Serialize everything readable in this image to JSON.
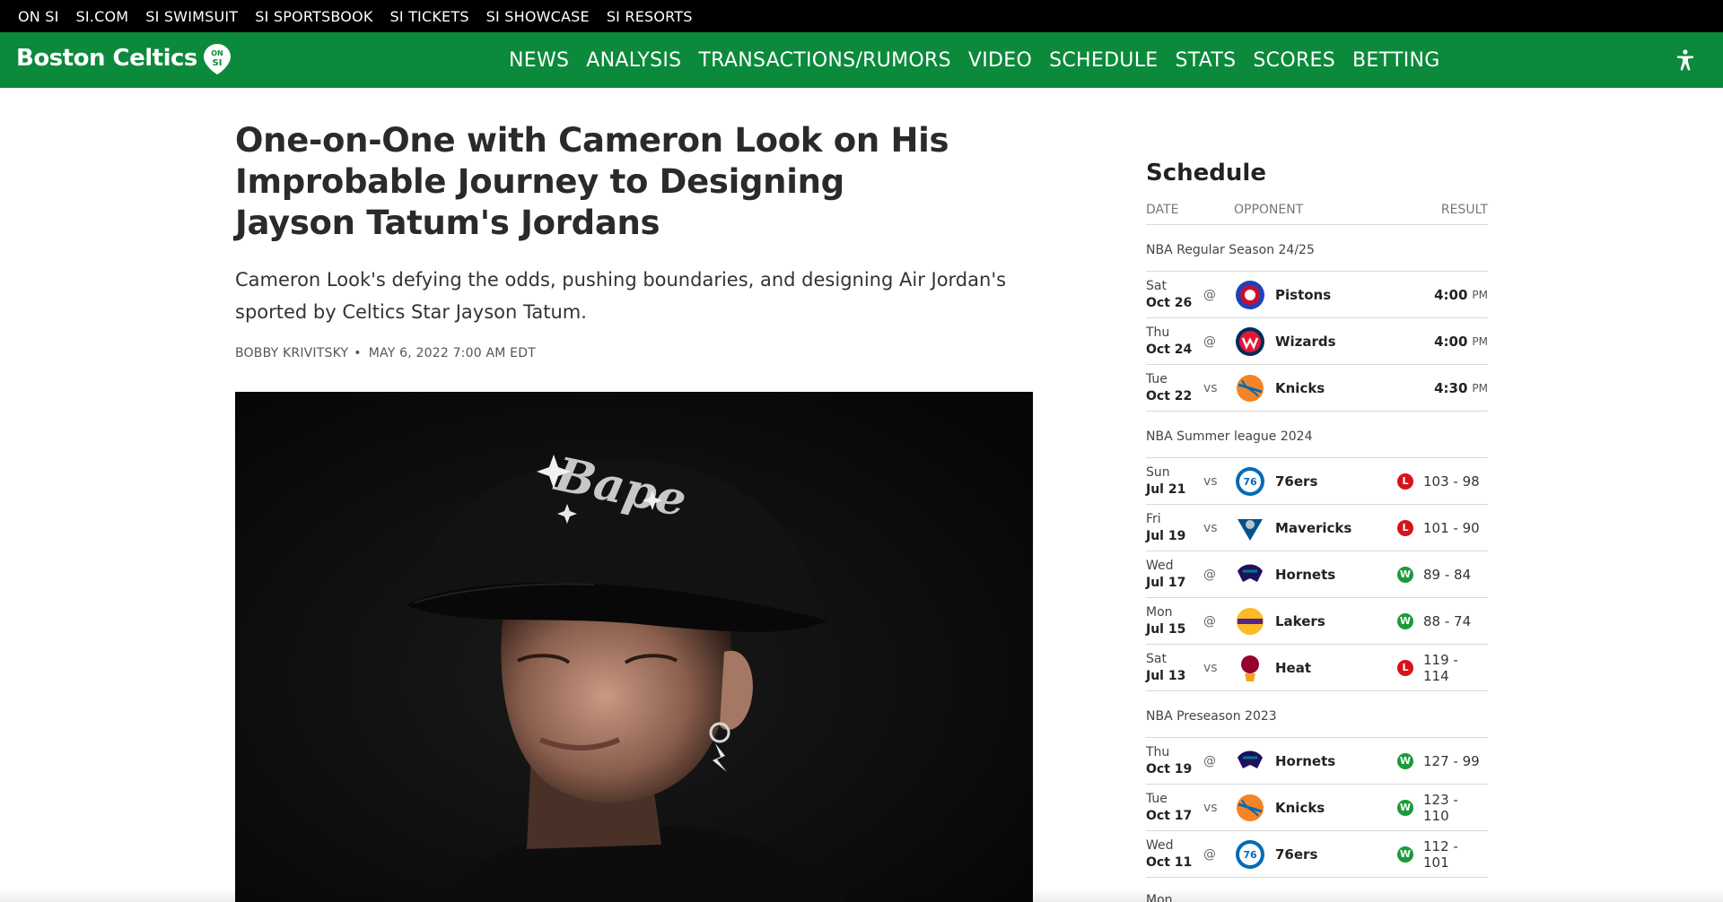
{
  "topbar": {
    "links": [
      "ON SI",
      "SI.COM",
      "SI SWIMSUIT",
      "SI SPORTSBOOK",
      "SI TICKETS",
      "SI SHOWCASE",
      "SI RESORTS"
    ]
  },
  "nav": {
    "brand": "Boston Celtics",
    "badge_text": "ON SI",
    "items": [
      "NEWS",
      "ANALYSIS",
      "TRANSACTIONS/RUMORS",
      "VIDEO",
      "SCHEDULE",
      "STATS",
      "SCORES",
      "BETTING"
    ],
    "accessibility_icon": "accessibility-icon"
  },
  "article": {
    "headline": "One-on-One with Cameron Look on His Improbable Journey to Designing Jayson Tatum's Jordans",
    "dek": "Cameron Look's defying the odds, pushing boundaries, and designing Air Jordan's sported by Celtics Star Jayson Tatum.",
    "author": "BOBBY KRIVITSKY",
    "dot": "•",
    "date": "MAY 6, 2022 7:00 AM EDT",
    "hat_text": "Bape"
  },
  "schedule": {
    "title": "Schedule",
    "columns": {
      "date": "DATE",
      "opponent": "OPPONENT",
      "result": "RESULT"
    },
    "sections": [
      {
        "label": "NBA Regular Season 24/25",
        "games": [
          {
            "dow": "Sat",
            "md": "Oct 26",
            "ha": "@",
            "team": "Pistons",
            "logo": "pistons-logo",
            "time": "4:00",
            "pm": "PM"
          },
          {
            "dow": "Thu",
            "md": "Oct 24",
            "ha": "@",
            "team": "Wizards",
            "logo": "wizards-logo",
            "time": "4:00",
            "pm": "PM"
          },
          {
            "dow": "Tue",
            "md": "Oct 22",
            "ha": "vs",
            "team": "Knicks",
            "logo": "knicks-logo",
            "time": "4:30",
            "pm": "PM"
          }
        ]
      },
      {
        "label": "NBA Summer league 2024",
        "games": [
          {
            "dow": "Sun",
            "md": "Jul 21",
            "ha": "vs",
            "team": "76ers",
            "logo": "76ers-logo",
            "wl": "L",
            "score": "103 - 98"
          },
          {
            "dow": "Fri",
            "md": "Jul 19",
            "ha": "vs",
            "team": "Mavericks",
            "logo": "mavericks-logo",
            "wl": "L",
            "score": "101 - 90"
          },
          {
            "dow": "Wed",
            "md": "Jul 17",
            "ha": "@",
            "team": "Hornets",
            "logo": "hornets-logo",
            "wl": "W",
            "score": "89 - 84"
          },
          {
            "dow": "Mon",
            "md": "Jul 15",
            "ha": "@",
            "team": "Lakers",
            "logo": "lakers-logo",
            "wl": "W",
            "score": "88 - 74"
          },
          {
            "dow": "Sat",
            "md": "Jul 13",
            "ha": "vs",
            "team": "Heat",
            "logo": "heat-logo",
            "wl": "L",
            "score": "119 - 114"
          }
        ]
      },
      {
        "label": "NBA Preseason 2023",
        "games": [
          {
            "dow": "Thu",
            "md": "Oct 19",
            "ha": "@",
            "team": "Hornets",
            "logo": "hornets-logo",
            "wl": "W",
            "score": "127 - 99"
          },
          {
            "dow": "Tue",
            "md": "Oct 17",
            "ha": "vs",
            "team": "Knicks",
            "logo": "knicks-logo",
            "wl": "W",
            "score": "123 - 110"
          },
          {
            "dow": "Wed",
            "md": "Oct 11",
            "ha": "@",
            "team": "76ers",
            "logo": "76ers-logo",
            "wl": "W",
            "score": "112 - 101"
          },
          {
            "dow": "Mon",
            "md": "",
            "ha": "",
            "team": "",
            "logo": "",
            "wl": "",
            "score": ""
          }
        ]
      }
    ]
  },
  "colors": {
    "brand_green": "#0b8a3b",
    "topbar": "#000000",
    "loss": "#d6131b",
    "win": "#1a9b3a"
  }
}
